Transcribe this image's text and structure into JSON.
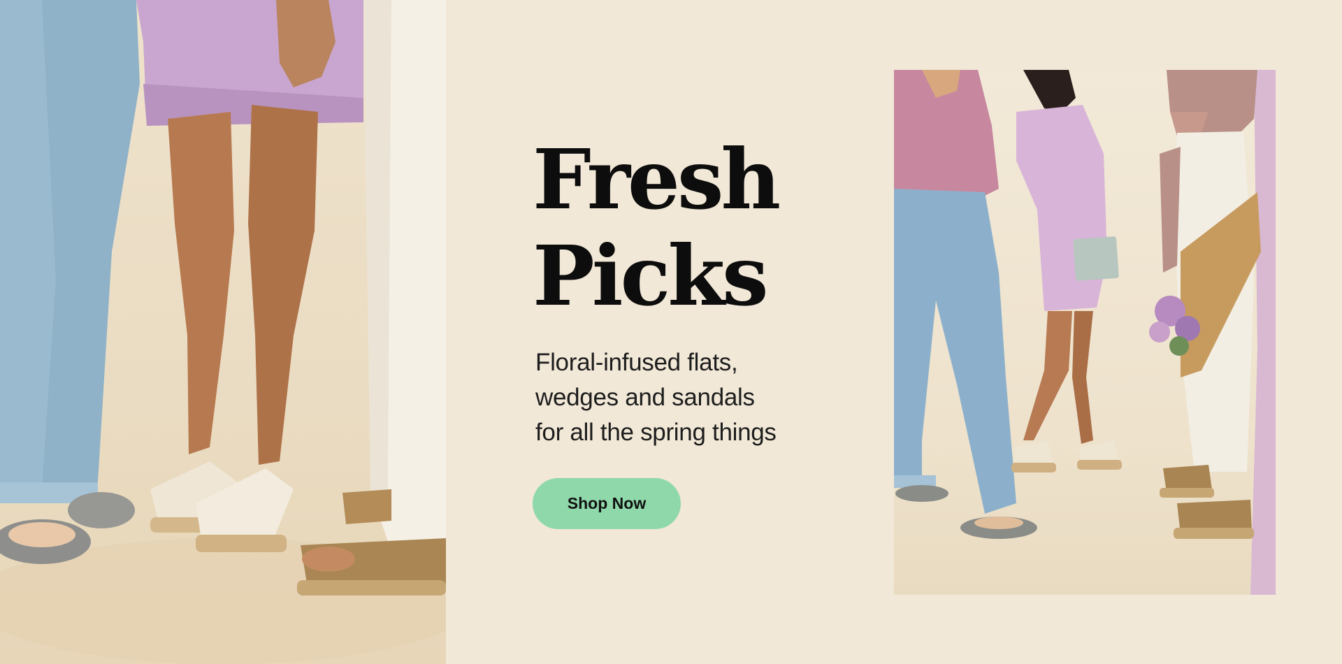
{
  "hero": {
    "headline_line1": "Fresh",
    "headline_line2": "Picks",
    "subhead_line1": "Floral-infused flats,",
    "subhead_line2": "wedges and sandals",
    "subhead_line3": "for all the spring things",
    "cta_label": "Shop Now"
  },
  "colors": {
    "background": "#f1e8d7",
    "cta": "#8fd8a9",
    "headline": "#0d0d0d",
    "accent_stripe": "#d9b8d2"
  },
  "images": {
    "left": "lifestyle-photo-shoes-legs",
    "right": "lifestyle-photo-group-walking"
  }
}
